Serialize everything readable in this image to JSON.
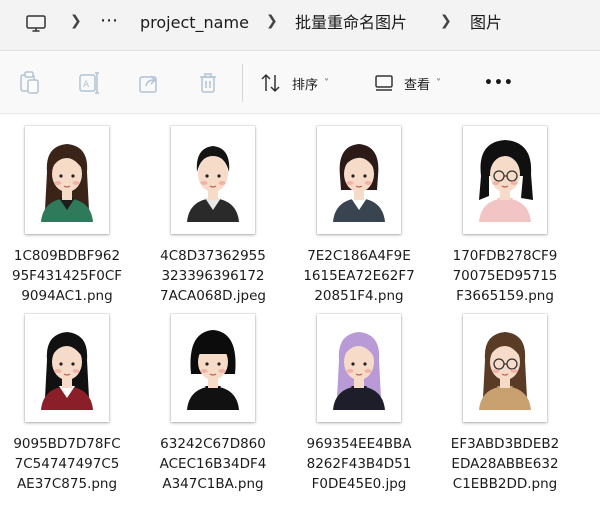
{
  "breadcrumb": {
    "items": [
      "project_name",
      "批量重命名图片",
      "图片"
    ],
    "more": "⋯"
  },
  "toolbar": {
    "sort_label": "排序",
    "view_label": "查看",
    "more": "•••"
  },
  "files": [
    {
      "name": "1C809BDBF96295F431425F0CF9094AC1.png",
      "lines": [
        "1C809BDBF962",
        "95F431425F0CF",
        "9094AC1.png"
      ],
      "hair": "#3a2418",
      "shirt": "#2f7a5a",
      "shirt2": "#1d1d1d",
      "style": "long"
    },
    {
      "name": "4C8D37362955323396396172 7ACA068D.jpeg",
      "lines": [
        "4C8D37362955",
        "323396396172",
        "7ACA068D.jpeg"
      ],
      "hair": "#141414",
      "shirt": "#2a2a2a",
      "shirt2": "#e8e8e8",
      "style": "short"
    },
    {
      "name": "7E2C186A4F9E1615EA72E62F720851F4.png",
      "lines": [
        "7E2C186A4F9E",
        "1615EA72E62F7",
        "20851F4.png"
      ],
      "hair": "#2b1a17",
      "shirt": "#3a4350",
      "shirt2": "#ffffff",
      "style": "mid"
    },
    {
      "name": "170FDB278CF970075ED95715F3665159.png",
      "lines": [
        "170FDB278CF9",
        "70075ED95715",
        "F3665159.png"
      ],
      "hair": "#101010",
      "shirt": "#f2c4c4",
      "shirt2": "#f2c4c4",
      "style": "curly"
    },
    {
      "name": "9095BD7D78FC7C54747497C5AE37C875.png",
      "lines": [
        "9095BD7D78FC",
        "7C54747497C5",
        "AE37C875.png"
      ],
      "hair": "#111111",
      "shirt": "#8a1f2a",
      "shirt2": "#ffffff",
      "style": "long"
    },
    {
      "name": "63242C67D860ACEC16B34DF4A347C1BA.png",
      "lines": [
        "63242C67D860",
        "ACEC16B34DF4",
        "A347C1BA.png"
      ],
      "hair": "#0c0c0c",
      "shirt": "#111111",
      "shirt2": "#111111",
      "style": "bob"
    },
    {
      "name": "969354EE4BBA8262F43B4D51F0DE45E0.jpg",
      "lines": [
        "969354EE4BBA",
        "8262F43B4D51",
        "F0DE45E0.jpg"
      ],
      "hair": "#b89ad6",
      "shirt": "#1e1e2a",
      "shirt2": "#1e1e2a",
      "style": "long"
    },
    {
      "name": "EF3ABD3BDEB2EDA28ABBE632C1EBB2DD.png",
      "lines": [
        "EF3ABD3BDEB2",
        "EDA28ABBE632",
        "C1EBB2DD.png"
      ],
      "hair": "#5a3b26",
      "shirt": "#c9a070",
      "shirt2": "#c9a070",
      "style": "long"
    }
  ]
}
